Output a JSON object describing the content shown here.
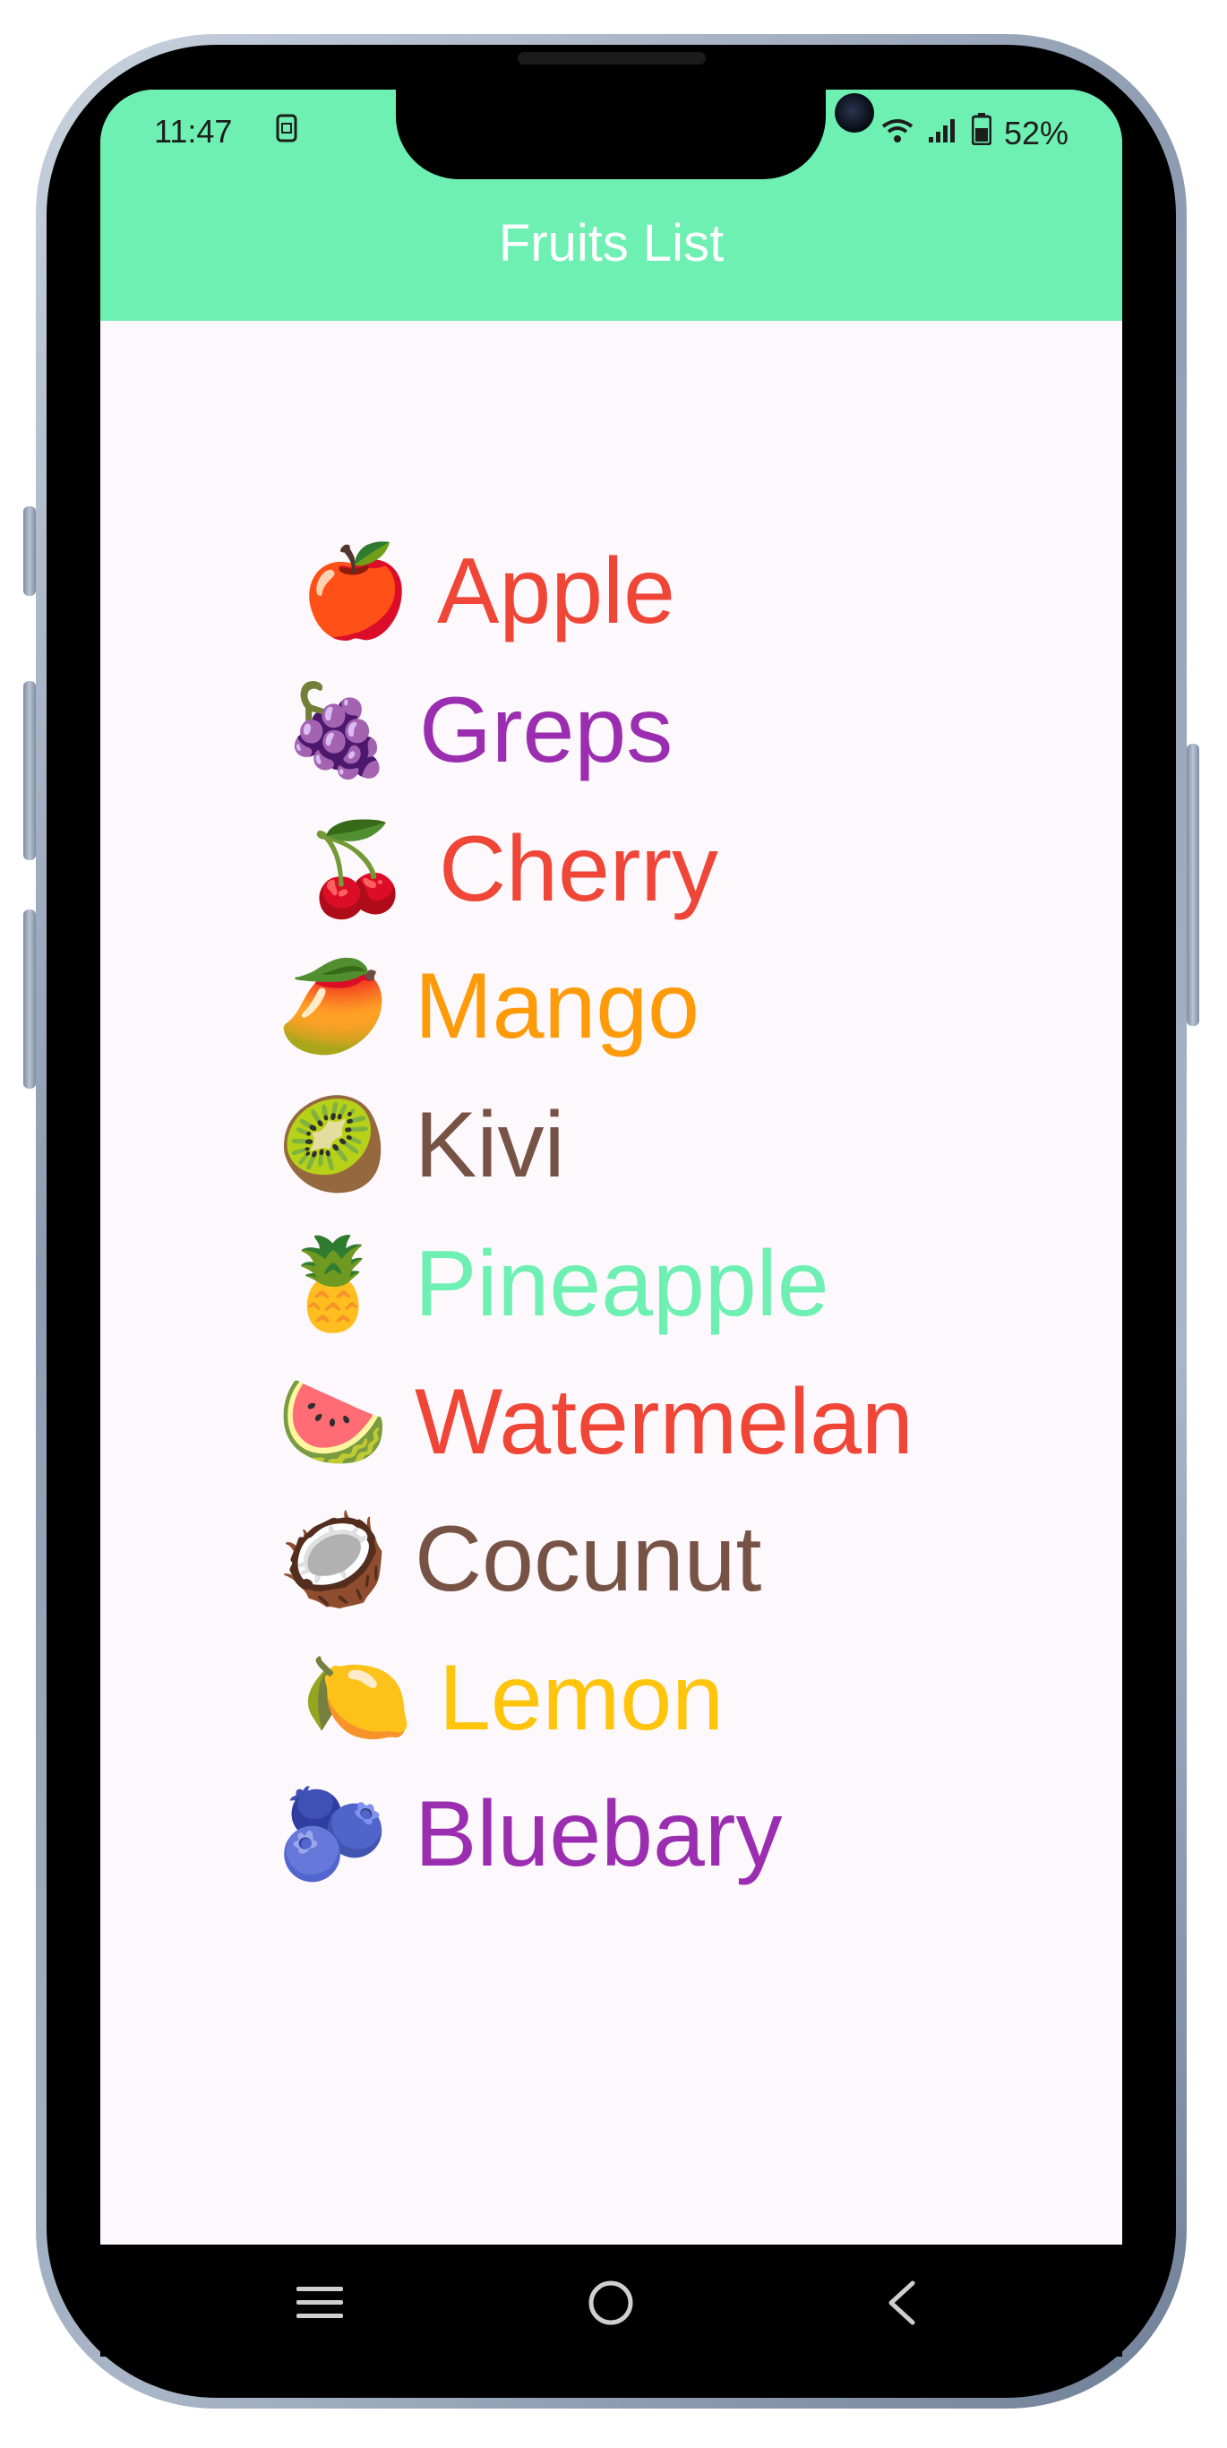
{
  "status_bar": {
    "time": "11:47",
    "battery": "52%"
  },
  "app_bar": {
    "title": "Fruits List",
    "color": "#6ef0b3"
  },
  "fruits": [
    {
      "emoji": "🍎",
      "name": "Apple",
      "color": "#ef4638"
    },
    {
      "emoji": "🍇",
      "name": "Greps",
      "color": "#9a2db0"
    },
    {
      "emoji": "🍒",
      "name": "Cherry",
      "color": "#ef4638"
    },
    {
      "emoji": "🥭",
      "name": "Mango",
      "color": "#ff9a08"
    },
    {
      "emoji": "🥝",
      "name": "Kivi",
      "color": "#775346"
    },
    {
      "emoji": "🍍",
      "name": "Pineapple",
      "color": "#6ef0b3"
    },
    {
      "emoji": "🍉",
      "name": "Watermelan",
      "color": "#ef4638"
    },
    {
      "emoji": "🥥",
      "name": "Cocunut",
      "color": "#775346"
    },
    {
      "emoji": "🍋",
      "name": "Lemon",
      "color": "#ffc40c"
    },
    {
      "emoji": "🫐",
      "name": "Bluebary",
      "color": "#9a2db0"
    }
  ],
  "icons": {
    "menu": "menu-icon",
    "home": "home-icon",
    "back": "back-icon"
  }
}
